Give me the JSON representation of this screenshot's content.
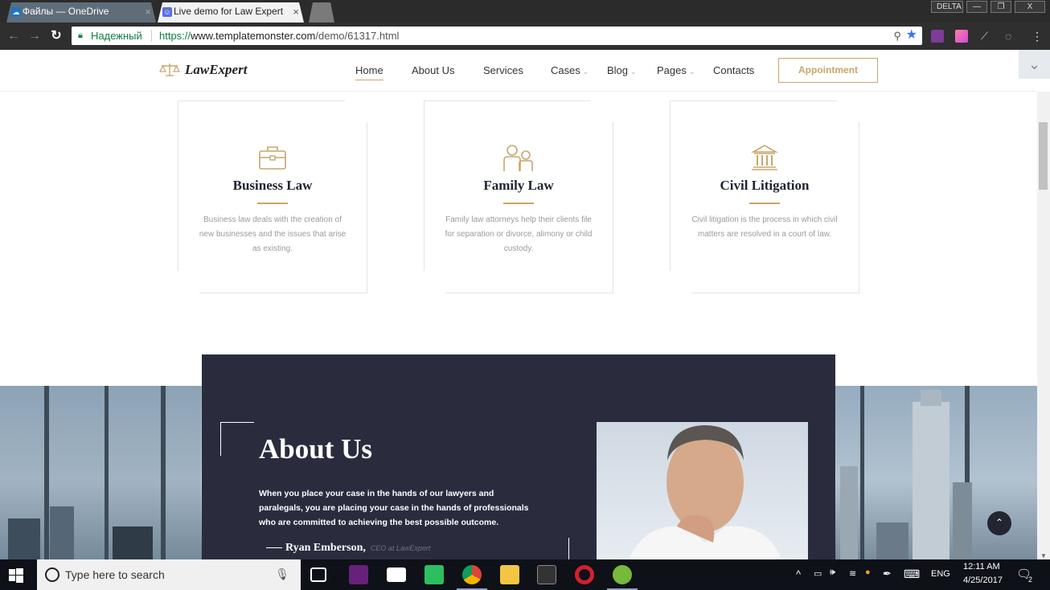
{
  "browser": {
    "tabs": [
      {
        "title": "Файлы — OneDrive",
        "icon": "onedrive-icon",
        "close": "×"
      },
      {
        "title": "Live demo for Law Expert",
        "icon": "templatemonster-icon",
        "close": "×"
      }
    ],
    "profile_label": "DELTA",
    "window_buttons": {
      "minimize": "—",
      "restore": "❐",
      "close": "X"
    },
    "secure_label": "Надежный",
    "url_scheme": "https://",
    "url_host": "www.templatemonster.com",
    "url_path": "/demo/61317.html"
  },
  "site": {
    "logo_text": "LawExpert",
    "nav": [
      {
        "label": "Home",
        "active": true,
        "dropdown": false
      },
      {
        "label": "About Us",
        "active": false,
        "dropdown": false
      },
      {
        "label": "Services",
        "active": false,
        "dropdown": false
      },
      {
        "label": "Cases",
        "active": false,
        "dropdown": true
      },
      {
        "label": "Blog",
        "active": false,
        "dropdown": true
      },
      {
        "label": "Pages",
        "active": false,
        "dropdown": true
      },
      {
        "label": "Contacts",
        "active": false,
        "dropdown": false
      }
    ],
    "appointment_label": "Appointment",
    "accent_color": "#c9a66b",
    "dark_panel_color": "#2a2c3e"
  },
  "services": [
    {
      "title": "Business Law",
      "icon": "briefcase-icon",
      "text": "Business law deals with the creation of new businesses and the issues that arise as existing."
    },
    {
      "title": "Family Law",
      "icon": "family-icon",
      "text": "Family law attorneys help their clients file for separation or divorce, alimony or child custody."
    },
    {
      "title": "Civil Litigation",
      "icon": "courthouse-icon",
      "text": "Civil litigation is the process in which civil matters are resolved in a court of law."
    }
  ],
  "about": {
    "title": "About Us",
    "text": "When you place your case in the hands of our lawyers and paralegals, you are placing your case in the hands of professionals who are committed to achieving the best possible outcome.",
    "quote_name": "Ryan Emberson,",
    "quote_role": "CEO at LawExpert"
  },
  "taskbar": {
    "search_placeholder": "Type here to search",
    "language": "ENG",
    "time": "12:11 AM",
    "date": "4/25/2017",
    "notification_count": "2"
  }
}
